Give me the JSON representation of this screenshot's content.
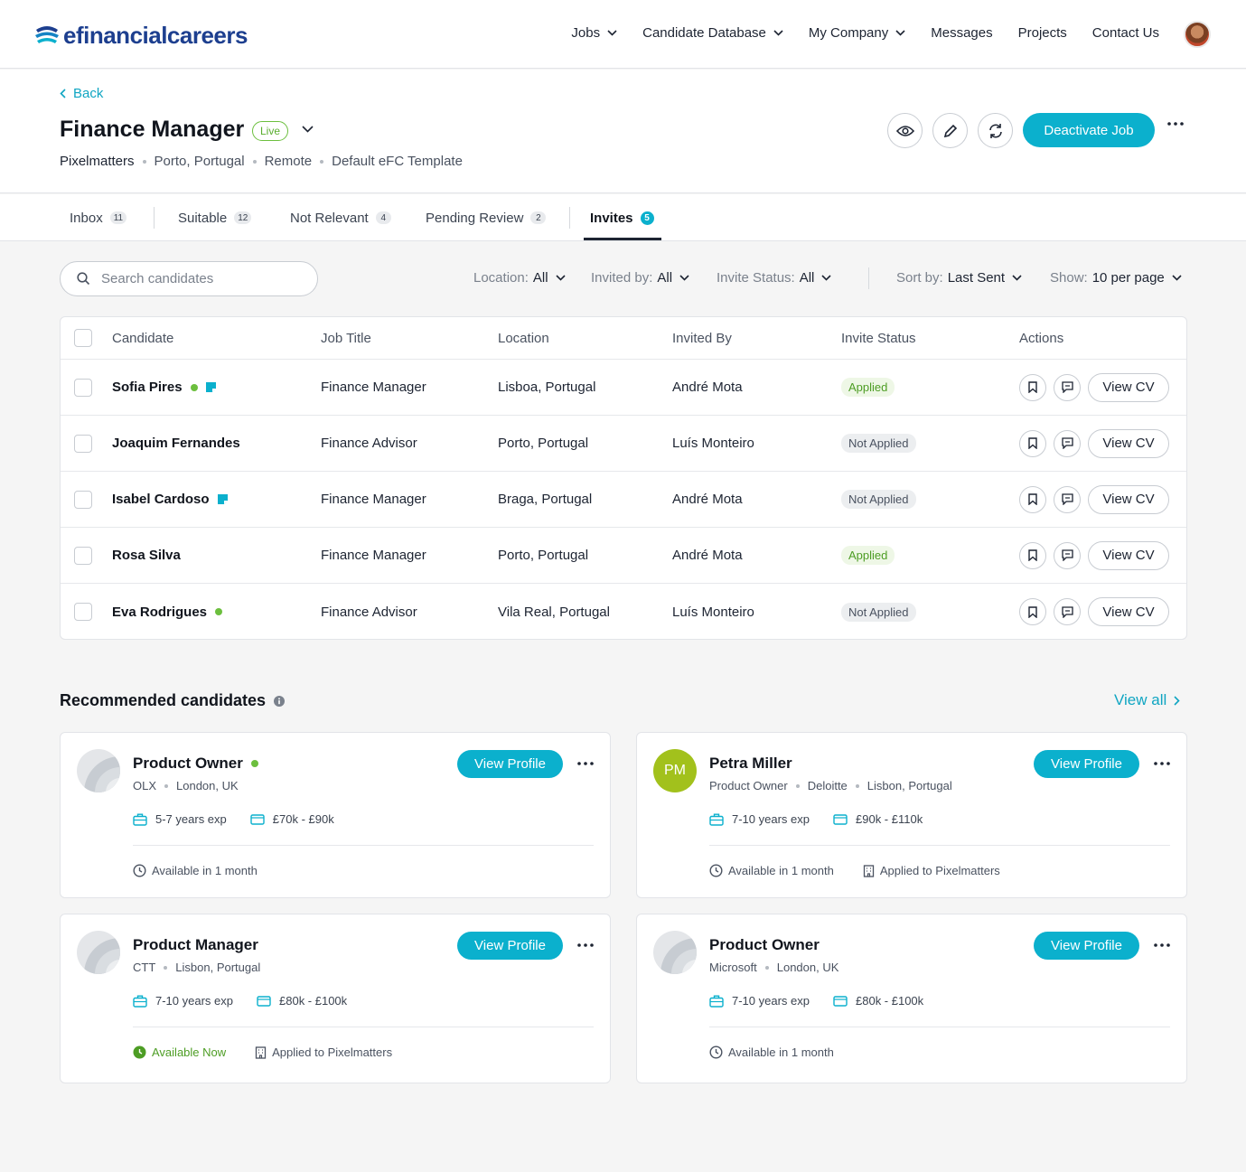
{
  "colors": {
    "accent": "#0bb0cd",
    "brand": "#1d3f8f",
    "live": "#6cbf3e",
    "applied": "#4d9d24"
  },
  "nav": {
    "logo_text": "efinancialcareers",
    "items": [
      "Jobs",
      "Candidate Database",
      "My Company",
      "Messages",
      "Projects",
      "Contact Us"
    ]
  },
  "header": {
    "back_label": "Back",
    "title": "Finance Manager",
    "status_badge": "Live",
    "company": "Pixelmatters",
    "location": "Porto, Portugal",
    "work_mode": "Remote",
    "template": "Default eFC Template",
    "deactivate_label": "Deactivate Job"
  },
  "tabs": [
    {
      "label": "Inbox",
      "count": "11"
    },
    {
      "label": "Suitable",
      "count": "12"
    },
    {
      "label": "Not Relevant",
      "count": "4"
    },
    {
      "label": "Pending Review",
      "count": "2"
    },
    {
      "label": "Invites",
      "count": "5"
    }
  ],
  "filters": {
    "search_placeholder": "Search candidates",
    "location": {
      "label": "Location:",
      "value": "All"
    },
    "invited_by": {
      "label": "Invited by:",
      "value": "All"
    },
    "invite_status": {
      "label": "Invite Status:",
      "value": "All"
    },
    "sort_by": {
      "label": "Sort by:",
      "value": "Last Sent"
    },
    "show": {
      "label": "Show:",
      "value": "10 per page"
    }
  },
  "table": {
    "headers": [
      "Candidate",
      "Job Title",
      "Location",
      "Invited By",
      "Invite Status",
      "Actions"
    ],
    "view_cv_label": "View CV",
    "rows": [
      {
        "name": "Sofia Pires",
        "job": "Finance Manager",
        "location": "Lisboa, Portugal",
        "invited_by": "André Mota",
        "status": "Applied"
      },
      {
        "name": "Joaquim Fernandes",
        "job": "Finance Advisor",
        "location": "Porto, Portugal",
        "invited_by": "Luís Monteiro",
        "status": "Not Applied"
      },
      {
        "name": "Isabel Cardoso",
        "job": "Finance Manager",
        "location": "Braga, Portugal",
        "invited_by": "André Mota",
        "status": "Not Applied"
      },
      {
        "name": "Rosa Silva",
        "job": "Finance Manager",
        "location": "Porto, Portugal",
        "invited_by": "André Mota",
        "status": "Applied"
      },
      {
        "name": "Eva Rodrigues",
        "job": "Finance Advisor",
        "location": "Vila Real, Portugal",
        "invited_by": "Luís Monteiro",
        "status": "Not Applied"
      }
    ]
  },
  "recommended": {
    "title": "Recommended candidates",
    "view_all_label": "View all",
    "view_profile_label": "View Profile",
    "cards": [
      {
        "title": "Product Owner",
        "company": "OLX",
        "location": "London, UK",
        "experience": "5-7 years exp",
        "salary": "£70k - £90k",
        "availability": "Available in 1 month",
        "applied": ""
      },
      {
        "title": "Petra Miller",
        "initials": "PM",
        "role": "Product Owner",
        "company": "Deloitte",
        "location": "Lisbon, Portugal",
        "experience": "7-10 years exp",
        "salary": "£90k - £110k",
        "availability": "Available in 1 month",
        "applied": "Applied to Pixelmatters"
      },
      {
        "title": "Product Manager",
        "company": "CTT",
        "location": "Lisbon, Portugal",
        "experience": "7-10 years exp",
        "salary": "£80k - £100k",
        "availability": "Available Now",
        "applied": "Applied to Pixelmatters"
      },
      {
        "title": "Product Owner",
        "company": "Microsoft",
        "location": "London, UK",
        "experience": "7-10 years exp",
        "salary": "£80k - £100k",
        "availability": "Available in 1 month",
        "applied": ""
      }
    ]
  }
}
